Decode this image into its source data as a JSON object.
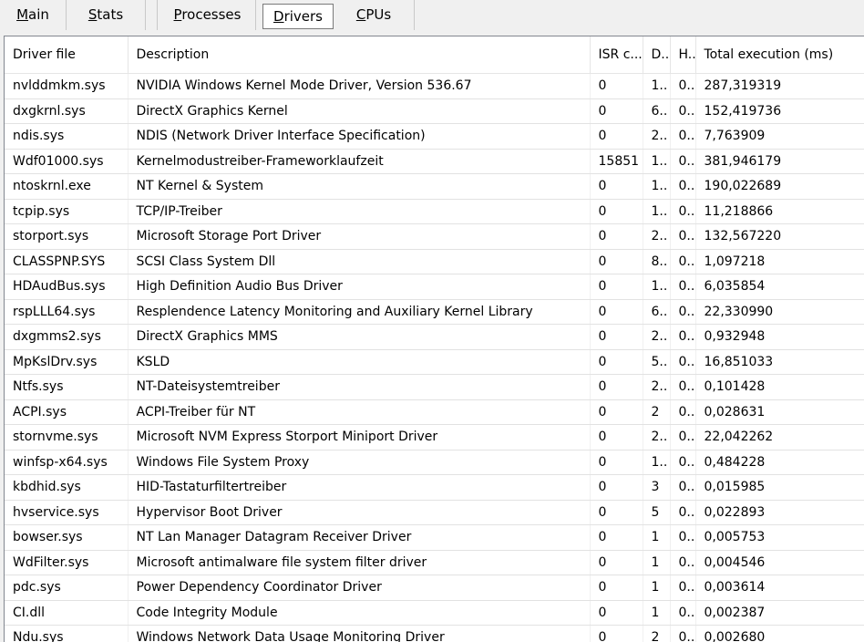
{
  "tabs": [
    {
      "label": "Main",
      "accel": "M",
      "rest": "ain"
    },
    {
      "label": "Stats",
      "accel": "S",
      "rest": "tats"
    },
    {
      "label": "Processes",
      "accel": "P",
      "rest": "rocesses"
    },
    {
      "label": "Drivers",
      "accel": "D",
      "rest": "rivers"
    },
    {
      "label": "CPUs",
      "accel": "C",
      "rest": "PUs"
    }
  ],
  "table": {
    "columns": [
      "Driver file",
      "Description",
      "ISR c...",
      "D..",
      "H..",
      "Total execution (ms)"
    ],
    "rows": [
      [
        "nvlddmkm.sys",
        "NVIDIA Windows Kernel Mode Driver, Version 536.67",
        "0",
        "1..",
        "0..",
        "287,319319"
      ],
      [
        "dxgkrnl.sys",
        "DirectX Graphics Kernel",
        "0",
        "6..",
        "0..",
        "152,419736"
      ],
      [
        "ndis.sys",
        "NDIS (Network Driver Interface Specification)",
        "0",
        "2..",
        "0..",
        "7,763909"
      ],
      [
        "Wdf01000.sys",
        "Kernelmodustreiber-Frameworklaufzeit",
        "15851",
        "1..",
        "0..",
        "381,946179"
      ],
      [
        "ntoskrnl.exe",
        "NT Kernel & System",
        "0",
        "1..",
        "0..",
        "190,022689"
      ],
      [
        "tcpip.sys",
        "TCP/IP-Treiber",
        "0",
        "1..",
        "0..",
        "11,218866"
      ],
      [
        "storport.sys",
        "Microsoft Storage Port Driver",
        "0",
        "2..",
        "0..",
        "132,567220"
      ],
      [
        "CLASSPNP.SYS",
        "SCSI Class System Dll",
        "0",
        "8..",
        "0..",
        "1,097218"
      ],
      [
        "HDAudBus.sys",
        "High Definition Audio Bus Driver",
        "0",
        "1..",
        "0..",
        "6,035854"
      ],
      [
        "rspLLL64.sys",
        "Resplendence Latency Monitoring and Auxiliary Kernel Library",
        "0",
        "6..",
        "0..",
        "22,330990"
      ],
      [
        "dxgmms2.sys",
        "DirectX Graphics MMS",
        "0",
        "2..",
        "0..",
        "0,932948"
      ],
      [
        "MpKslDrv.sys",
        "KSLD",
        "0",
        "5..",
        "0..",
        "16,851033"
      ],
      [
        "Ntfs.sys",
        "NT-Dateisystemtreiber",
        "0",
        "2..",
        "0..",
        "0,101428"
      ],
      [
        "ACPI.sys",
        "ACPI-Treiber für NT",
        "0",
        "2",
        "0..",
        "0,028631"
      ],
      [
        "stornvme.sys",
        "Microsoft NVM Express Storport Miniport Driver",
        "0",
        "2..",
        "0..",
        "22,042262"
      ],
      [
        "winfsp-x64.sys",
        "Windows File System Proxy",
        "0",
        "1..",
        "0..",
        "0,484228"
      ],
      [
        "kbdhid.sys",
        "HID-Tastaturfiltertreiber",
        "0",
        "3",
        "0..",
        "0,015985"
      ],
      [
        "hvservice.sys",
        "Hypervisor Boot Driver",
        "0",
        "5",
        "0..",
        "0,022893"
      ],
      [
        "bowser.sys",
        "NT Lan Manager Datagram Receiver Driver",
        "0",
        "1",
        "0..",
        "0,005753"
      ],
      [
        "WdFilter.sys",
        "Microsoft antimalware file system filter driver",
        "0",
        "1",
        "0..",
        "0,004546"
      ],
      [
        "pdc.sys",
        "Power Dependency Coordinator Driver",
        "0",
        "1",
        "0..",
        "0,003614"
      ],
      [
        "CI.dll",
        "Code Integrity Module",
        "0",
        "1",
        "0..",
        "0,002387"
      ],
      [
        "Ndu.sys",
        "Windows Network Data Usage Monitoring Driver",
        "0",
        "2",
        "0..",
        "0,002680"
      ]
    ]
  }
}
